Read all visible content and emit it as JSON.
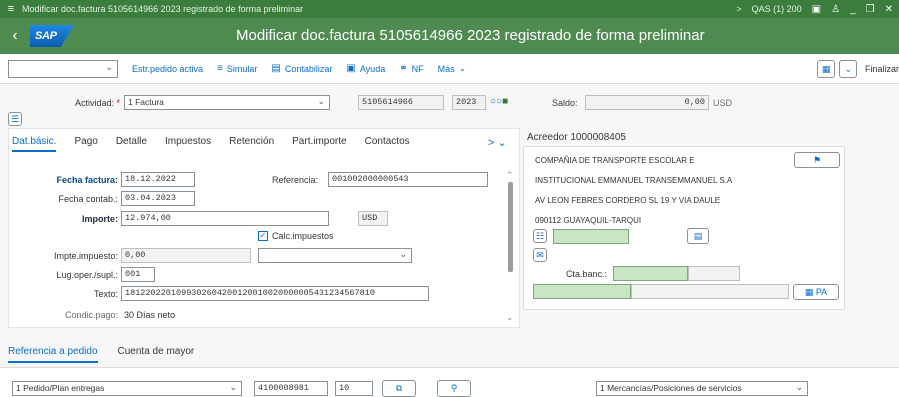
{
  "window": {
    "title": "Modificar doc.factura 5105614966 2023 registrado de forma preliminar",
    "system": "QAS (1) 200"
  },
  "shell": {
    "logo_text": "SAP",
    "title": "Modificar doc.factura 5105614966 2023 registrado de forma preliminar"
  },
  "toolbar": {
    "select_value": "",
    "estr_pedido": "Estr.pedido activa",
    "simular": "Simular",
    "contabilizar": "Contabilizar",
    "ayuda": "Ayuda",
    "nf": "NF",
    "mas": "Más",
    "finalizar": "Finalizar"
  },
  "header": {
    "actividad_label": "Actividad:",
    "actividad_value": "1 Factura",
    "doc_number": "5105614966",
    "doc_year": "2023",
    "saldo_label": "Saldo:",
    "saldo_value": "0,00",
    "saldo_currency": "USD"
  },
  "tabs": [
    "Dat.básic.",
    "Pago",
    "Detalle",
    "Impuestos",
    "Retención",
    "Part.importe",
    "Contactos"
  ],
  "form": {
    "fecha_factura_label": "Fecha factura:",
    "fecha_factura": "18.12.2022",
    "referencia_label": "Referencia:",
    "referencia": "001002000000543",
    "fecha_contab_label": "Fecha contab.:",
    "fecha_contab": "03.04.2023",
    "importe_label": "Importe:",
    "importe": "12.974,00",
    "moneda": "USD",
    "calc_impuestos": "Calc.impuestos",
    "impte_impuesto_label": "Impte.impuesto:",
    "impte_impuesto": "0,00",
    "lug_oper_label": "Lug.oper./supl.:",
    "lug_oper": "001",
    "texto_label": "Texto:",
    "texto": "1812202201099302604200120010020000005431234567810",
    "condic_pago_label": "Condic.pago:",
    "condic_pago": "30 Días neto"
  },
  "acreedor": {
    "title": "Acreedor 1000008405",
    "line1": "COMPAÑIA DE TRANSPORTE ESCOLAR E",
    "line2": "INSTITUCIONAL EMMANUEL TRANSEMMANUEL S.A",
    "line3": "AV LEON FEBRES CORDERO SL 19 Y VIA DAULE",
    "line4": "090112 GUAYAQUIL-TARQUI",
    "cta_banc_label": "Cta.banc.:",
    "pa_button": "PA"
  },
  "bottom": {
    "tab1": "Referencia a pedido",
    "tab2": "Cuenta de mayor",
    "tipo_pedido": "1 Pedido/Plan entregas",
    "pedido": "4100008981",
    "posicion": "10",
    "mercancias": "1 Mercancías/Posiciones de servicios"
  }
}
